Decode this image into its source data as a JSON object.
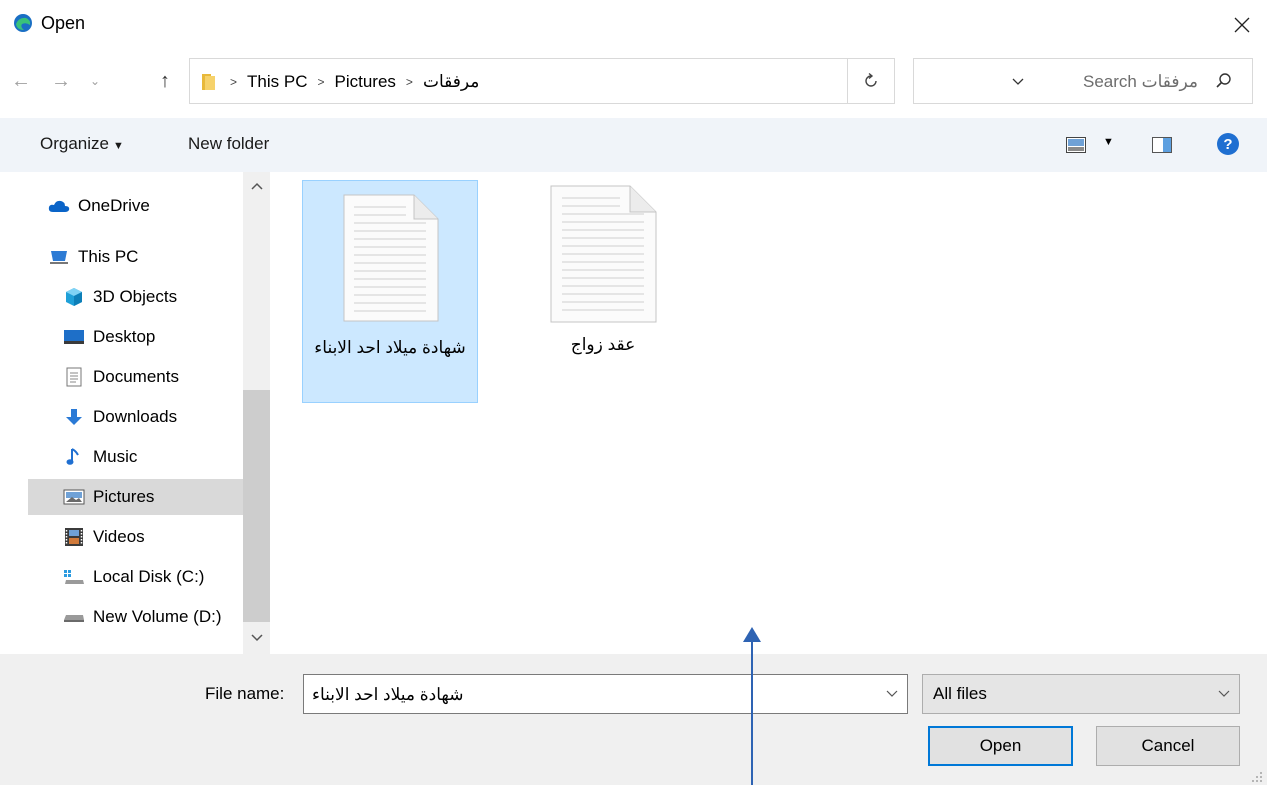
{
  "window": {
    "title": "Open"
  },
  "address": {
    "breadcrumbs": [
      "This PC",
      "Pictures",
      "مرفقات"
    ]
  },
  "search": {
    "placeholder": "مرفقات Search"
  },
  "toolbar": {
    "organize_label": "Organize",
    "new_folder_label": "New folder"
  },
  "sidebar": {
    "items": [
      {
        "label": "OneDrive",
        "icon": "onedrive-icon"
      },
      {
        "label": "This PC",
        "icon": "computer-icon"
      },
      {
        "label": "3D Objects",
        "icon": "cube-icon"
      },
      {
        "label": "Desktop",
        "icon": "desktop-icon"
      },
      {
        "label": "Documents",
        "icon": "documents-icon"
      },
      {
        "label": "Downloads",
        "icon": "download-arrow-icon"
      },
      {
        "label": "Music",
        "icon": "music-note-icon"
      },
      {
        "label": "Pictures",
        "icon": "pictures-icon"
      },
      {
        "label": "Videos",
        "icon": "film-icon"
      },
      {
        "label": "Local Disk (C:)",
        "icon": "drive-icon"
      },
      {
        "label": "New Volume (D:)",
        "icon": "drive-icon"
      }
    ],
    "selected": "Pictures"
  },
  "files": [
    {
      "name": "شهادة ميلاد احد الابناء",
      "selected": true,
      "icon": "document-file-icon"
    },
    {
      "name": "عقد زواج",
      "selected": false,
      "icon": "document-file-icon"
    }
  ],
  "footer": {
    "file_name_label": "File name:",
    "file_name_value": "شهادة ميلاد احد الابناء",
    "file_type_value": "All files",
    "open_label": "Open",
    "cancel_label": "Cancel"
  },
  "colors": {
    "accent": "#0078d7",
    "selection_fill": "#cce8ff",
    "annotation_arrow": "#2e63b3"
  }
}
